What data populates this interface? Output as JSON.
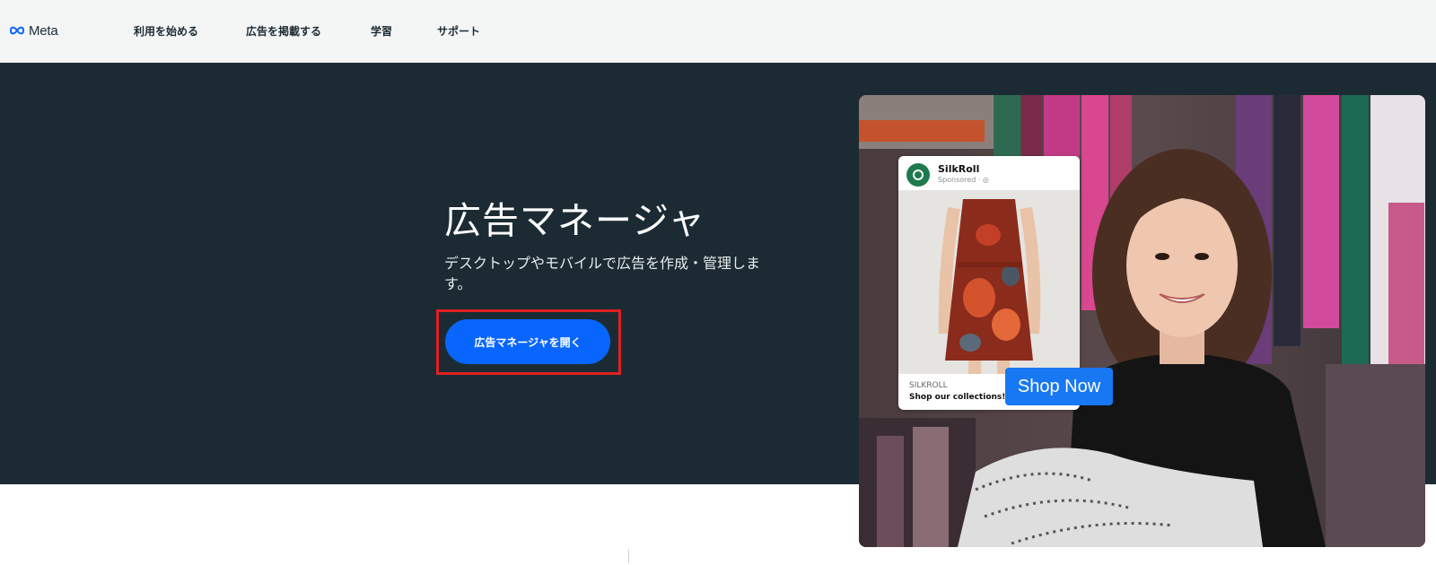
{
  "nav": {
    "logo_text": "Meta",
    "items": [
      {
        "label": "利用を始める"
      },
      {
        "label": "広告を掲載する"
      },
      {
        "label": "学習"
      },
      {
        "label": "サポート"
      }
    ]
  },
  "hero": {
    "title": "広告マネージャ",
    "description": "デスクトップやモバイルで広告を作成・管理します。",
    "cta_label": "広告マネージャを開く"
  },
  "ad": {
    "brand": "SilkRoll",
    "sponsored": "Sponsored · ◎",
    "footer_brand": "SILKROLL",
    "footer_tagline": "Shop our collections!",
    "cta": "Shop Now"
  },
  "colors": {
    "hero_bg": "#1c2b33",
    "cta_blue": "#0866ff",
    "highlight_red": "#e02020",
    "shop_now_blue": "#1877f2"
  }
}
